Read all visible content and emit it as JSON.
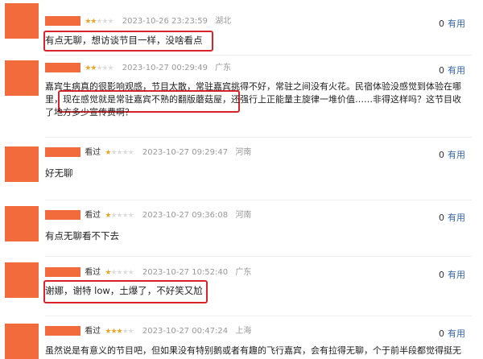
{
  "colors": {
    "accent_orange": "#f26b3c",
    "star": "#f0a321",
    "highlight": "#d9232b",
    "link": "#3366aa"
  },
  "reviews": [
    {
      "seen": "",
      "rating": 2,
      "time": "2023-10-26 23:23:59",
      "location": "湖北",
      "votes": "0",
      "vote_label": "有用",
      "lines": [
        "有点无聊，想访谈节目一样，没啥看点"
      ]
    },
    {
      "seen": "",
      "rating": 2,
      "time": "2023-10-27 00:29:49",
      "location": "广东",
      "votes": "0",
      "vote_label": "有用",
      "lines": [
        "嘉宾生病真的很影响观感，节目太散，常驻嘉宾挑得不好，常驻之间没有火花。民宿体验没感觉到体验在哪",
        "里，现在感觉就是常驻嘉宾不熟的翻版蘑菇屋，还强行上正能量主旋律一堆价值……非得这样吗？这节目收",
        "了地方多少宣传费啊？"
      ]
    },
    {
      "seen": "看过",
      "rating": 1,
      "time": "2023-10-27 09:29:47",
      "location": "河南",
      "votes": "0",
      "vote_label": "有用",
      "lines": [
        "好无聊"
      ]
    },
    {
      "seen": "看过",
      "rating": 1,
      "time": "2023-10-27 09:36:08",
      "location": "河南",
      "votes": "0",
      "vote_label": "有用",
      "lines": [
        "有点无聊看不下去"
      ]
    },
    {
      "seen": "看过",
      "rating": 1,
      "time": "2023-10-27 10:52:40",
      "location": "广东",
      "votes": "0",
      "vote_label": "有用",
      "lines": [
        "谢娜，谢特  low，土爆了，不好笑又尬"
      ]
    },
    {
      "seen": "看过",
      "rating": 3,
      "time": "2023-10-27 00:47:24",
      "location": "上海",
      "votes": "0",
      "vote_label": "有用",
      "lines": [
        "虽然说是有意义的节目吧，但如果没有特别鹅或者有趣的飞行嘉宾，会有拉得无聊，个于前半段都觉得挺无"
      ]
    }
  ]
}
